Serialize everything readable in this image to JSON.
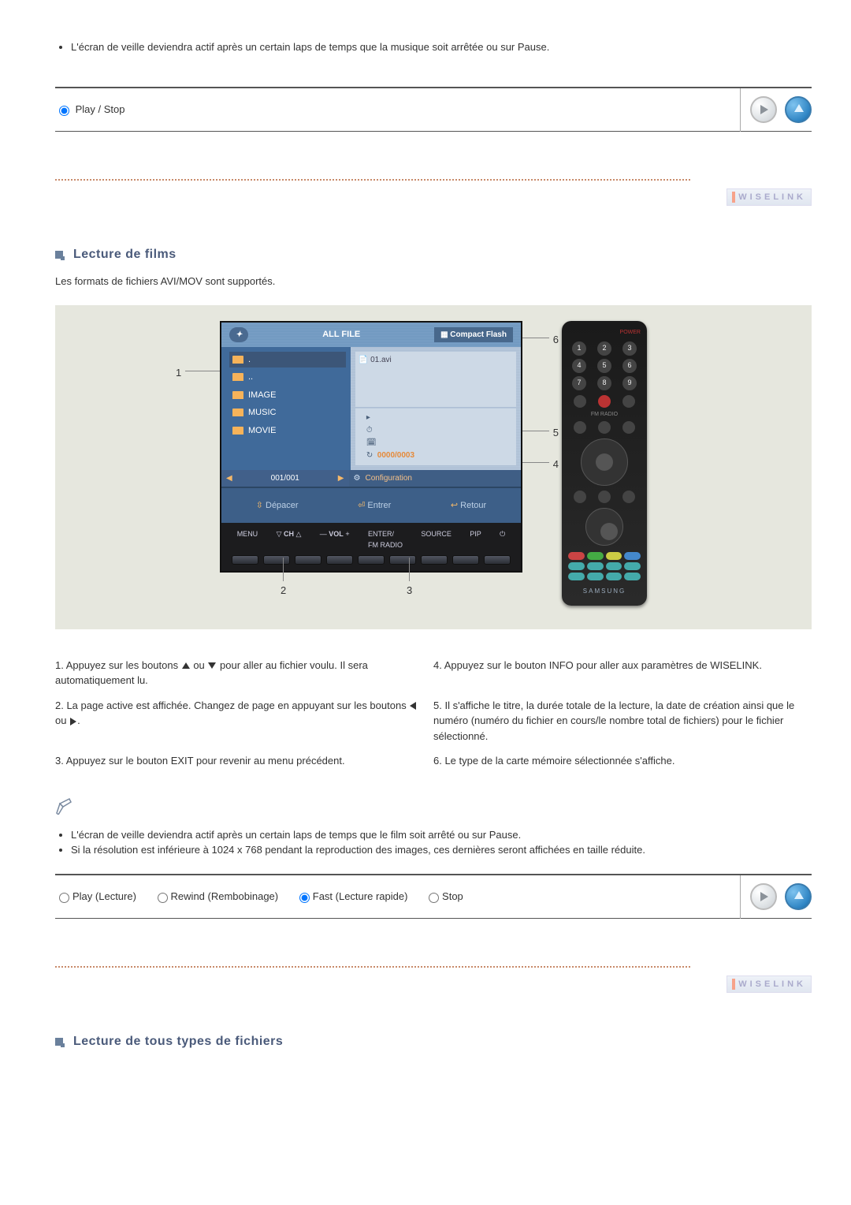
{
  "music_note": "L'écran de veille deviendra actif après un certain laps de temps que la musique soit arrêtée ou sur Pause.",
  "music_control": {
    "play_stop": "Play / Stop"
  },
  "wiselink_label": "WISELINK",
  "section_films": {
    "title": "Lecture de films",
    "intro": "Les formats de fichiers AVI/MOV sont supportés."
  },
  "tv": {
    "all_file": "ALL FILE",
    "compact_flash": "Compact Flash",
    "preview_name": "01.avi",
    "counter": "0000/0003",
    "items": [
      {
        "label": "."
      },
      {
        "label": ".."
      },
      {
        "label": "IMAGE"
      },
      {
        "label": "MUSIC"
      },
      {
        "label": "MOVIE"
      }
    ],
    "page": "001/001",
    "config": "Configuration",
    "hint_move": "Dépacer",
    "hint_enter": "Entrer",
    "hint_return": "Retour",
    "btns": {
      "menu": "MENU",
      "ch": "CH",
      "vol": "VOL",
      "enter": "ENTER/\nFM RADIO",
      "source": "SOURCE",
      "pip": "PIP"
    }
  },
  "remote": {
    "power": "POWER",
    "brand": "SAMSUNG",
    "keys": [
      "1",
      "2",
      "3",
      "4",
      "5",
      "6",
      "7",
      "8",
      "9"
    ]
  },
  "callouts": {
    "n1": "1",
    "n2": "2",
    "n3": "3",
    "n4": "4",
    "n5": "5",
    "n6": "6"
  },
  "instructions": {
    "r1l_a": "1. Appuyez sur les boutons ",
    "r1l_b": " ou ",
    "r1l_c": " pour aller au fichier voulu. Il sera automatiquement lu.",
    "r1r": "4. Appuyez sur le bouton INFO pour aller aux paramètres de WISELINK.",
    "r2l_a": "2. La page active est affichée. Changez de page en appuyant sur les boutons ",
    "r2l_b": " ou ",
    "r2l_c": ".",
    "r2r": "5. Il s'affiche le titre, la durée totale de la lecture, la date de création ainsi que le numéro (numéro du fichier en cours/le nombre total de fichiers) pour le fichier sélectionné.",
    "r3l": "3. Appuyez sur le bouton EXIT pour revenir au menu précédent.",
    "r3r": "6. Le type de la carte mémoire sélectionnée s'affiche."
  },
  "film_notes": [
    "L'écran de veille deviendra actif après un certain laps de temps que le film soit arrêté ou sur Pause.",
    "Si la résolution est inférieure à 1024 x 768 pendant la reproduction des images, ces dernières seront affichées en taille réduite."
  ],
  "film_control": {
    "play": "Play (Lecture)",
    "rewind": "Rewind (Rembobinage)",
    "fast": "Fast (Lecture rapide)",
    "stop": "Stop"
  },
  "section_all": {
    "title": "Lecture de tous types de fichiers"
  }
}
